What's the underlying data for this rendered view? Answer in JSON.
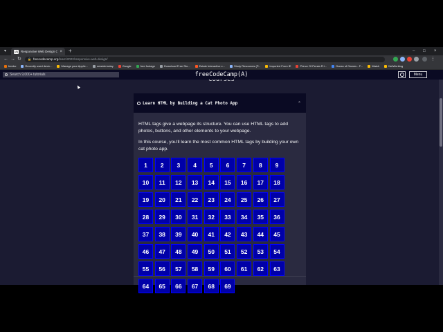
{
  "browser": {
    "tab_title": "Responsive Web Design Certific...",
    "tab_favicon": "(A)",
    "url_host": "freecodecamp.org",
    "url_path": "/learn/2022/responsive-web-design/",
    "bookmarks": [
      {
        "label": "freebo",
        "color": "#e8710a"
      },
      {
        "label": "Recently used devic...",
        "color": "#8ab4f8"
      },
      {
        "label": "Manage your Applic...",
        "color": "#fbbc04"
      },
      {
        "label": "newtab.today",
        "color": "#9aa0a6"
      },
      {
        "label": "Google",
        "color": "#ea4335"
      },
      {
        "label": "free footage",
        "color": "#34a853"
      },
      {
        "label": "Download Free Sto...",
        "color": "#9aa0a6"
      },
      {
        "label": "Estate Interactive c...",
        "color": "#ff5722"
      },
      {
        "label": "Study Resources (P...",
        "color": "#8ab4f8"
      },
      {
        "label": "Imported From IE",
        "color": "#fbbc04"
      },
      {
        "label": "Prince Of Persia Pri...",
        "color": "#ea4335"
      },
      {
        "label": "Ocean of Games - F...",
        "color": "#4285f4"
      },
      {
        "label": "Watch",
        "color": "#fbbc04"
      },
      {
        "label": "NetWorking",
        "color": "#fbbc04"
      }
    ]
  },
  "nav": {
    "search_placeholder": "Search 9,000+ tutorials",
    "logo": "freeCodeCamp(A)",
    "menu_label": "Menu"
  },
  "page": {
    "section_heading": "Courses"
  },
  "course": {
    "title": "Learn HTML by Building a Cat Photo App",
    "desc1": "HTML tags give a webpage its structure. You can use HTML tags to add photos, buttons, and other elements to your webpage.",
    "desc2": "In this course, you'll learn the most common HTML tags by building your own cat photo app.",
    "steps": [
      "1",
      "2",
      "3",
      "4",
      "5",
      "6",
      "7",
      "8",
      "9",
      "10",
      "11",
      "12",
      "13",
      "14",
      "15",
      "16",
      "17",
      "18",
      "19",
      "20",
      "21",
      "22",
      "23",
      "24",
      "25",
      "26",
      "27",
      "28",
      "29",
      "30",
      "31",
      "32",
      "33",
      "34",
      "35",
      "36",
      "37",
      "38",
      "39",
      "40",
      "41",
      "42",
      "43",
      "44",
      "45",
      "46",
      "47",
      "48",
      "49",
      "50",
      "51",
      "52",
      "53",
      "54",
      "55",
      "56",
      "57",
      "58",
      "59",
      "60",
      "61",
      "62",
      "63",
      "64",
      "65",
      "66",
      "67",
      "68",
      "69"
    ]
  },
  "colors": {
    "nav_bg": "#0a0a23",
    "page_bg": "#1b1b32",
    "card_bg": "#2a2a40",
    "step_bg": "#0000a8"
  }
}
